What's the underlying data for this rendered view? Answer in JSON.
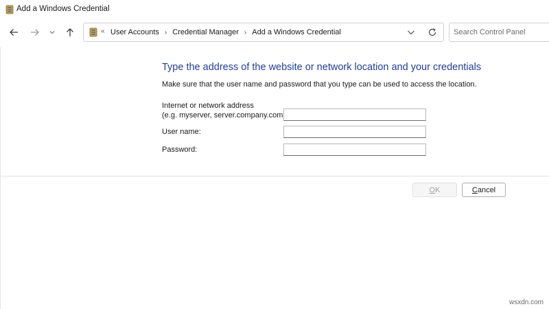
{
  "window": {
    "title": "Add a Windows Credential",
    "icon": "credential-manager-icon"
  },
  "nav": {
    "back_icon": "arrow-left-icon",
    "forward_icon": "arrow-right-icon",
    "recent_icon": "chevron-down-icon",
    "up_icon": "arrow-up-icon",
    "address_chevron": "«",
    "breadcrumbs": [
      "User Accounts",
      "Credential Manager",
      "Add a Windows Credential"
    ],
    "separator": "›",
    "search_placeholder": "Search Control Panel"
  },
  "form": {
    "heading": "Type the address of the website or network location and your credentials",
    "subtext": "Make sure that the user name and password that you type can be used to access the location.",
    "address_label_line1": "Internet or network address",
    "address_label_line2": "(e.g. myserver, server.company.com):",
    "address_value": "",
    "username_label": "User name:",
    "username_value": "",
    "password_label": "Password:",
    "password_value": ""
  },
  "buttons": {
    "ok_prefix": "",
    "ok_underlined": "O",
    "ok_rest": "K",
    "cancel_prefix": "",
    "cancel_underlined": "C",
    "cancel_rest": "ancel",
    "ok_enabled": false
  },
  "watermark": "wsxdn.com",
  "colors": {
    "heading": "#1e3f9c",
    "border": "#d0d0d0"
  }
}
